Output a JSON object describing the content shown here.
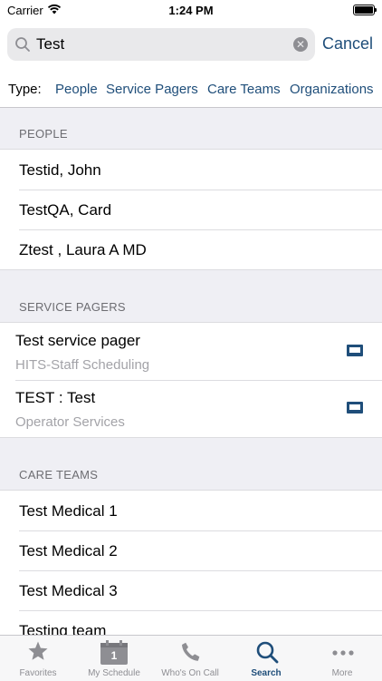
{
  "status": {
    "carrier": "Carrier",
    "time": "1:24 PM"
  },
  "search": {
    "query": "Test",
    "cancel_label": "Cancel"
  },
  "types": {
    "label": "Type:",
    "options": [
      "People",
      "Service Pagers",
      "Care Teams",
      "Organizations"
    ]
  },
  "sections": {
    "people": {
      "header": "PEOPLE",
      "items": [
        "Testid, John",
        "TestQA, Card",
        "Ztest , Laura A MD"
      ]
    },
    "pagers": {
      "header": "SERVICE PAGERS",
      "items": [
        {
          "title": "Test service pager",
          "subtitle": "HITS-Staff Scheduling"
        },
        {
          "title": "TEST : Test",
          "subtitle": "Operator Services"
        }
      ]
    },
    "teams": {
      "header": "CARE TEAMS",
      "items": [
        "Test Medical 1",
        "Test Medical 2",
        "Test Medical 3",
        "Testing team"
      ]
    }
  },
  "tabbar": {
    "tabs": [
      {
        "label": "Favorites",
        "icon": "star-icon"
      },
      {
        "label": "My Schedule",
        "icon": "calendar-icon",
        "badge": "1"
      },
      {
        "label": "Who's On Call",
        "icon": "phone-icon"
      },
      {
        "label": "Search",
        "icon": "search-icon"
      },
      {
        "label": "More",
        "icon": "more-icon"
      }
    ],
    "active": "Search"
  },
  "colors": {
    "accent": "#1f4e7a",
    "inactive": "#8e8e93",
    "background": "#efeff4"
  }
}
